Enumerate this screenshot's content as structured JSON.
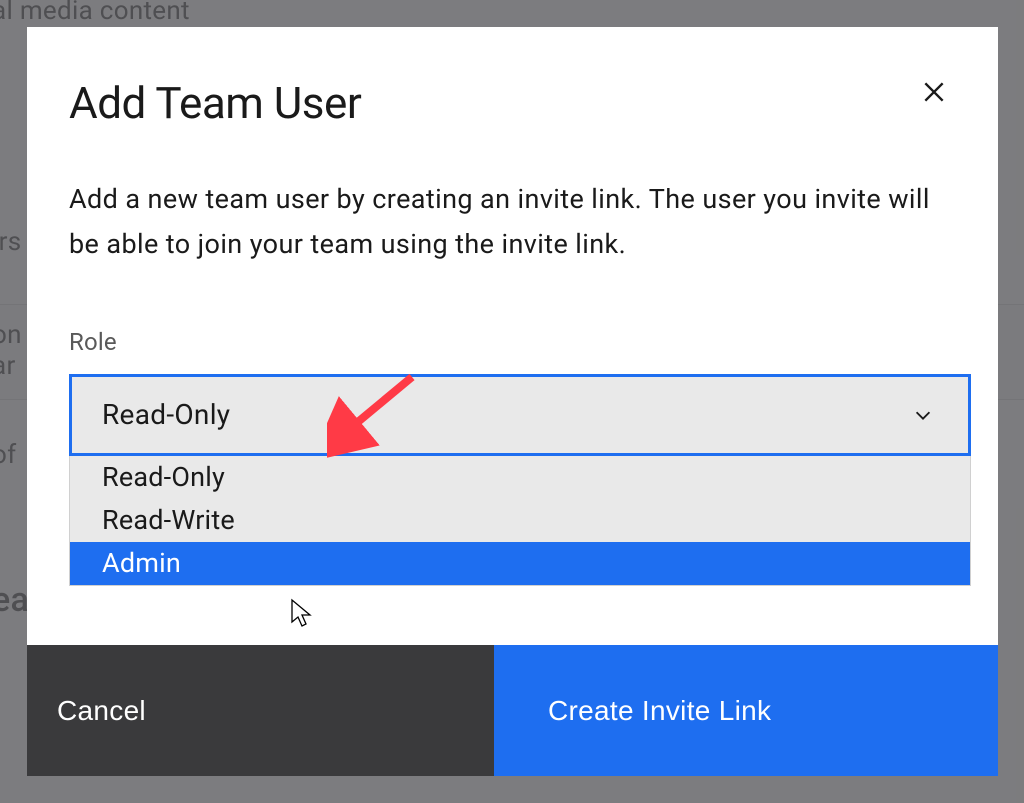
{
  "background": {
    "t1": "al media content",
    "t2": "irs",
    "t3a": "on",
    "t3b": "ar",
    "t4": "of",
    "t5": "ea"
  },
  "modal": {
    "title": "Add Team User",
    "description": "Add a new team user by creating an invite link. The user you invite will be able to join your team using the invite link.",
    "role_label": "Role",
    "select": {
      "selected": "Read-Only",
      "options": [
        {
          "label": "Read-Only",
          "highlight": false
        },
        {
          "label": "Read-Write",
          "highlight": false
        },
        {
          "label": "Admin",
          "highlight": true
        }
      ]
    },
    "footer": {
      "cancel": "Cancel",
      "confirm": "Create Invite Link"
    }
  }
}
